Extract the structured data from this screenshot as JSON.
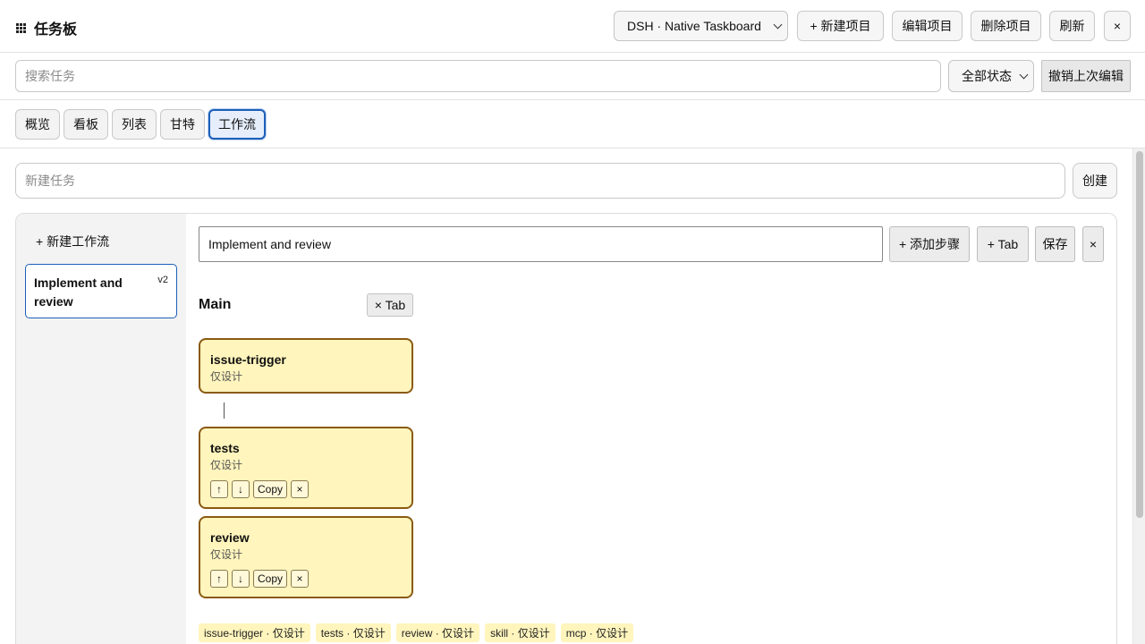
{
  "header": {
    "title": "任务板",
    "project_select": "DSH · Native Taskboard",
    "new_project": "+ 新建项目",
    "edit_project": "编辑项目",
    "delete_project": "删除项目",
    "refresh": "刷新",
    "close": "×"
  },
  "search": {
    "placeholder": "搜索任务",
    "status_filter": "全部状态",
    "undo": "撤销上次编辑"
  },
  "tabs": [
    {
      "label": "概览"
    },
    {
      "label": "看板"
    },
    {
      "label": "列表"
    },
    {
      "label": "甘特"
    },
    {
      "label": "工作流",
      "active": true
    }
  ],
  "new_task": {
    "placeholder": "新建任务",
    "create": "创建"
  },
  "workflow_sidebar": {
    "new_workflow": "+ 新建工作流",
    "items": [
      {
        "name": "Implement and review",
        "version": "v2",
        "selected": true
      }
    ]
  },
  "editor": {
    "name_value": "Implement and review",
    "add_step": "+ 添加步骤",
    "add_tab": "+ Tab",
    "save": "保存",
    "close": "×",
    "tab_title": "Main",
    "remove_tab": "× Tab",
    "steps": [
      {
        "name": "issue-trigger",
        "status": "仅设计"
      },
      {
        "name": "tests",
        "status": "仅设计",
        "controls": [
          "↑",
          "↓",
          "Copy",
          "×"
        ]
      },
      {
        "name": "review",
        "status": "仅设计",
        "controls": [
          "↑",
          "↓",
          "Copy",
          "×"
        ]
      }
    ],
    "chips": [
      "issue-trigger · 仅设计",
      "tests · 仅设计",
      "review · 仅设计",
      "skill · 仅设计",
      "mcp · 仅设计"
    ]
  },
  "colors": {
    "accent": "#1d5fb8",
    "step_bg": "#fff5bd",
    "step_border": "#8a5a12"
  }
}
